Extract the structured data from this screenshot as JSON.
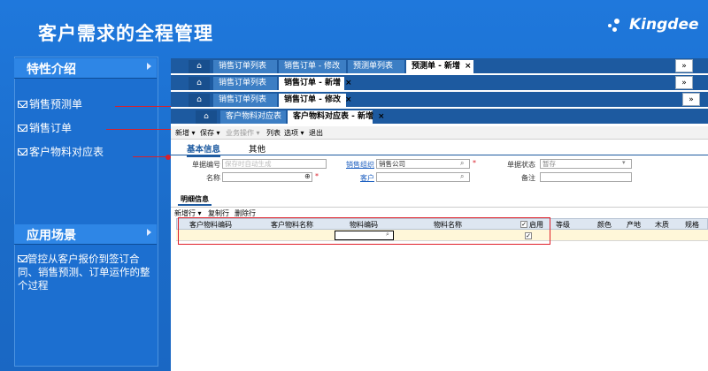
{
  "slide": {
    "title": "客户需求的全程管理",
    "logo_text": "Kingdee"
  },
  "left": {
    "features_heading": "特性介绍",
    "features": [
      "销售预测单",
      "销售订单",
      "客户物料对应表"
    ],
    "scenario_heading": "应用场景",
    "scenario_text": "管控从客户报价到签订合同、销售预测、订单运作的整个过程"
  },
  "app": {
    "row1_tabs": [
      "销售订单列表",
      "销售订单 - 修改",
      "预测单列表",
      "预测单 - 新增"
    ],
    "row2_tabs": [
      "销售订单列表",
      "销售订单 - 新增"
    ],
    "row3_tabs": [
      "销售订单列表",
      "销售订单 - 修改"
    ],
    "row4_tabs": [
      "客户物料对应表",
      "客户物料对应表 - 新增"
    ],
    "toolbar": [
      "新增 ▾",
      "保存 ▾",
      "业务操作 ▾",
      "列表",
      "选项 ▾",
      "退出"
    ],
    "form_tabs": [
      "基本信息",
      "其他"
    ],
    "fields": {
      "bill_no_label": "单据编号",
      "bill_no_placeholder": "保存时自动生成",
      "name_label": "名称",
      "sales_org_label": "销售组织",
      "sales_org_value": "销售公司",
      "customer_label": "客户",
      "status_label": "单据状态",
      "status_value": "暂存",
      "remark_label": "备注"
    },
    "detail_tab": "明细信息",
    "detail_toolbar": [
      "新增行 ▾",
      "复制行",
      "删除行"
    ],
    "grid_headers": [
      "客户物料编码",
      "客户物料名称",
      "物料编码",
      "物料名称",
      "启用",
      "等级",
      "颜色",
      "产地",
      "木质",
      "规格"
    ]
  },
  "colors": {
    "accent_red": "#d9202a",
    "tab_blue": "#1d5aa0"
  }
}
